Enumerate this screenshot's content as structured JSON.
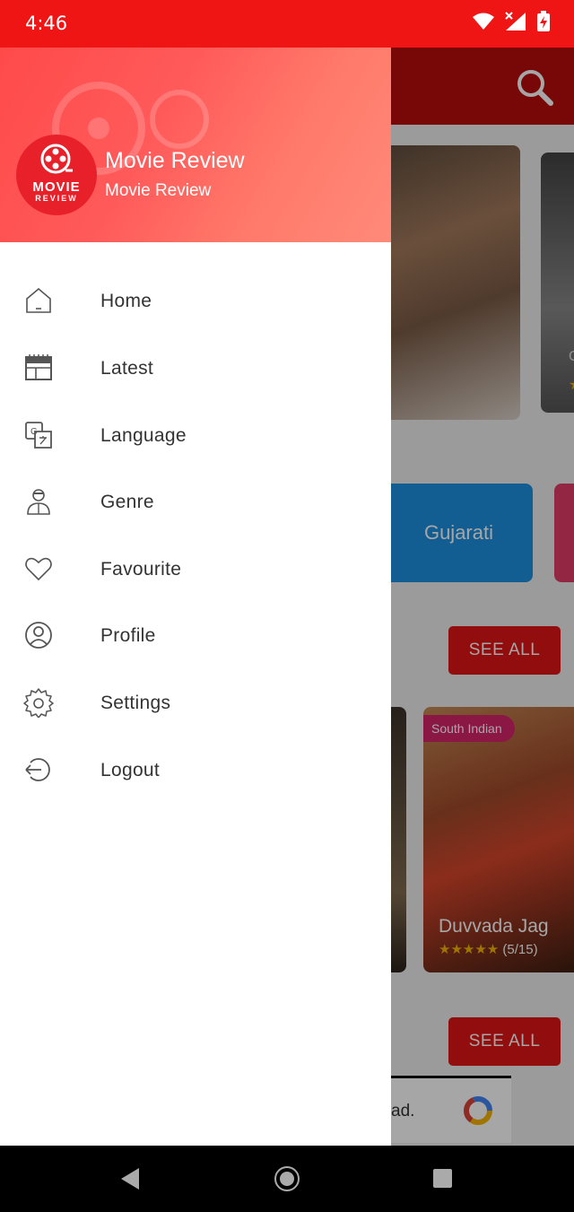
{
  "status_bar": {
    "time": "4:46"
  },
  "background": {
    "poster_2_partial_text": "C",
    "poster_2_partial_star": "★",
    "language_chip": "Gujarati",
    "see_all_label": "SEE ALL",
    "tag": "South Indian",
    "movie_title": "Duvvada Jag",
    "movie_stars": "★★★★★",
    "movie_rating": "(5/15)",
    "ad_text": "ad."
  },
  "drawer": {
    "logo": {
      "line1": "MOVIE",
      "line2": "REVIEW"
    },
    "user_name": "Movie Review",
    "user_subtitle": "Movie Review",
    "menu": [
      {
        "label": "Home",
        "icon": "home-icon"
      },
      {
        "label": "Latest",
        "icon": "calendar-icon"
      },
      {
        "label": "Language",
        "icon": "translate-icon"
      },
      {
        "label": "Genre",
        "icon": "person-icon"
      },
      {
        "label": "Favourite",
        "icon": "heart-icon"
      },
      {
        "label": "Profile",
        "icon": "account-icon"
      },
      {
        "label": "Settings",
        "icon": "gear-icon"
      },
      {
        "label": "Logout",
        "icon": "logout-icon"
      }
    ]
  },
  "colors": {
    "status_bar": "#f01515",
    "accent_red": "#e01414",
    "chip_blue": "#1d8fe0",
    "tag_pink": "#d6246a"
  }
}
